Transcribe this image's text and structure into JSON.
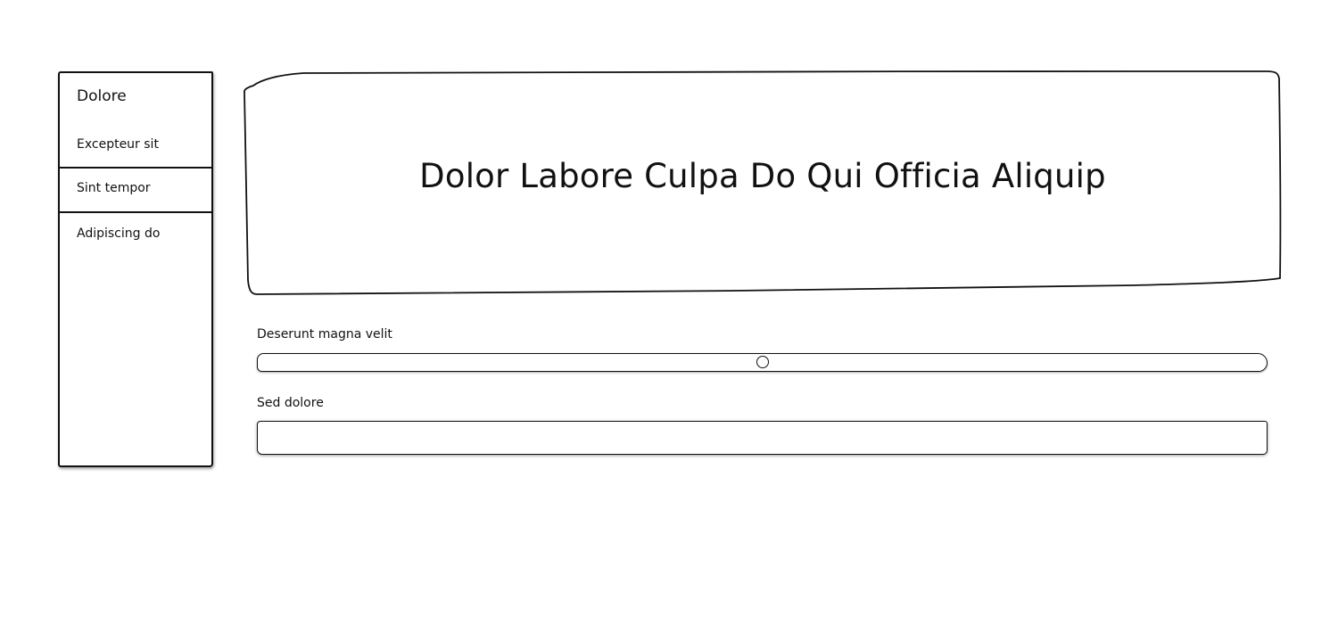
{
  "sidebar": {
    "title": "Dolore",
    "items": [
      {
        "label": "Excepteur sit"
      },
      {
        "label": "Sint tempor"
      },
      {
        "label": "Adipiscing do"
      }
    ]
  },
  "hero": {
    "title": "Dolor Labore Culpa Do Qui Officia Aliquip"
  },
  "slider": {
    "label": "Deserunt magna velit",
    "value_fraction": 0.5
  },
  "text_field": {
    "label": "Sed dolore",
    "value": "",
    "placeholder": ""
  }
}
